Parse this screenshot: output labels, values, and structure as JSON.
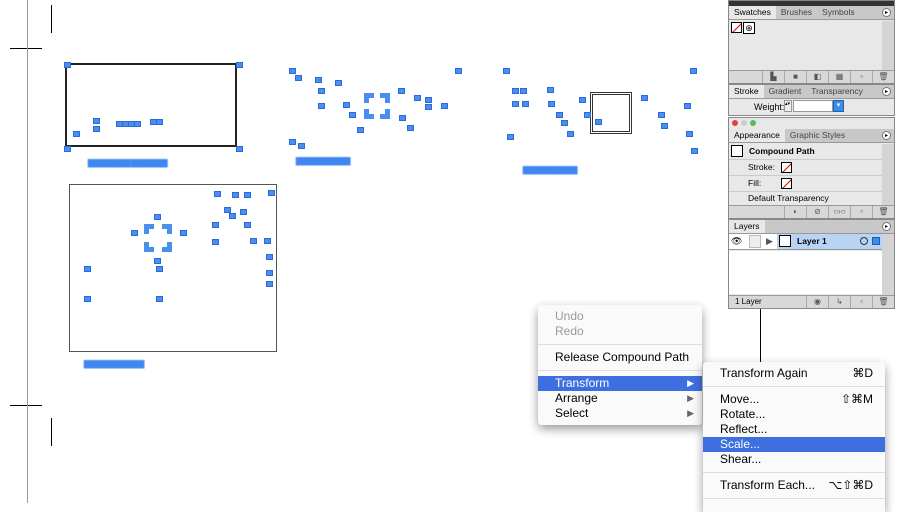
{
  "panels": {
    "swatches_group": {
      "tabs": [
        "Swatches",
        "Brushes",
        "Symbols"
      ]
    },
    "stroke_group": {
      "tabs": [
        "Stroke",
        "Gradient",
        "Transparency"
      ],
      "weight_label": "Weight:",
      "weight_value": ""
    },
    "appearance_group": {
      "tabs": [
        "Appearance",
        "Graphic Styles"
      ],
      "object": "Compound Path",
      "stroke_label": "Stroke:",
      "fill_label": "Fill:",
      "transparency": "Default Transparency"
    },
    "layers": {
      "tab": "Layers",
      "layer_name": "Layer 1",
      "count": "1 Layer"
    }
  },
  "context_menu": {
    "items": [
      {
        "label": "Undo",
        "enabled": false
      },
      {
        "label": "Redo",
        "enabled": false
      },
      {
        "label": "Release Compound Path"
      },
      {
        "label": "Transform",
        "highlighted": true
      },
      {
        "label": "Arrange"
      },
      {
        "label": "Select"
      }
    ]
  },
  "transform_submenu": {
    "items": [
      {
        "label": "Transform Again",
        "shortcut": "⌘D"
      },
      {
        "label": "Move...",
        "shortcut": "⇧⌘M"
      },
      {
        "label": "Rotate..."
      },
      {
        "label": "Reflect..."
      },
      {
        "label": "Scale...",
        "highlighted": true
      },
      {
        "label": "Shear..."
      },
      {
        "label": "Transform Each...",
        "shortcut": "⌥⇧⌘D"
      }
    ]
  },
  "colors": {
    "selection": "#4a8ef0",
    "menu_highlight": "#3e6fe0",
    "layer_row": "#b8d4f5"
  }
}
